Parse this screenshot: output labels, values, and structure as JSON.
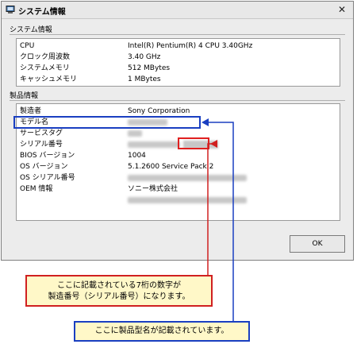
{
  "window": {
    "title": "システム情報",
    "close_glyph": "✕"
  },
  "system_section": {
    "heading": "システム情報",
    "rows": [
      {
        "label": "CPU",
        "value": "Intel(R) Pentium(R) 4 CPU 3.40GHz"
      },
      {
        "label": "クロック周波数",
        "value": "3.40 GHz"
      },
      {
        "label": "システムメモリ",
        "value": "512 MBytes"
      },
      {
        "label": "キャッシュメモリ",
        "value": "1 MBytes"
      }
    ]
  },
  "product_section": {
    "heading": "製品情報",
    "rows": [
      {
        "label": "製造者",
        "value": "Sony Corporation"
      },
      {
        "label": "モデル名",
        "value": ""
      },
      {
        "label": "サービスタグ",
        "value": ""
      },
      {
        "label": "シリアル番号",
        "value": ""
      },
      {
        "label": "BIOS バージョン",
        "value": "1004"
      },
      {
        "label": "OS バージョン",
        "value": "5.1.2600 Service Pack 2"
      },
      {
        "label": "OS シリアル番号",
        "value": ""
      },
      {
        "label": "OEM 情報",
        "value": "ソニー株式会社"
      }
    ]
  },
  "ok_button": "OK",
  "callouts": {
    "serial": [
      "ここに記載されている7桁の数字が",
      "製造番号（シリアル番号）になります。"
    ],
    "model": "ここに製品型名が記載されています。"
  },
  "colors": {
    "highlight_blue": "#1a3fc1",
    "highlight_red": "#e02020",
    "callout_bg": "#fff8c8"
  },
  "icons": {
    "title_icon": "computer-icon",
    "close_icon": "close-icon"
  }
}
